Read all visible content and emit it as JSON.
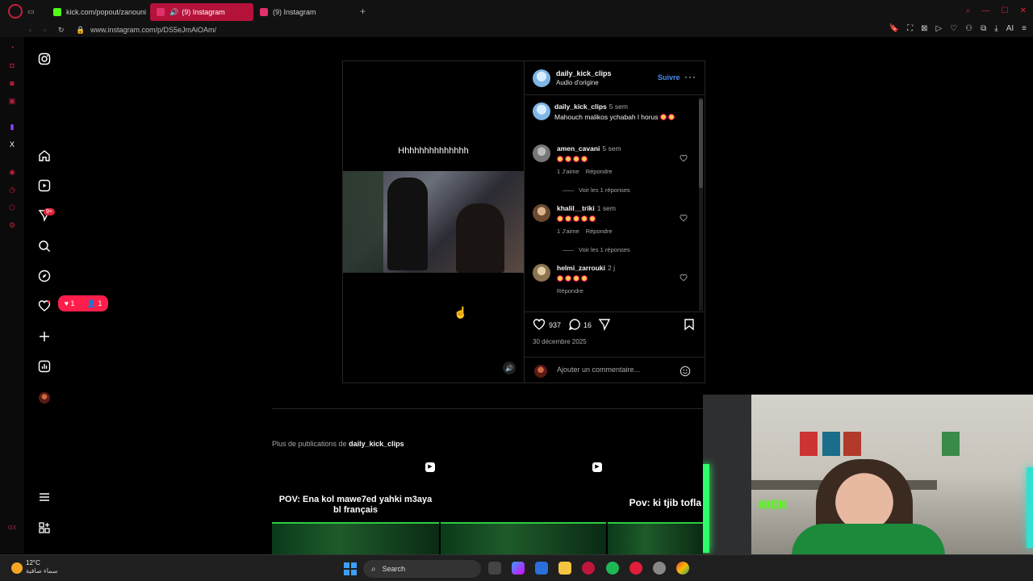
{
  "browser": {
    "tabs": [
      {
        "title": "kick.com/popout/zanouni",
        "favicon_color": "#53fc18"
      },
      {
        "title": "(9) Instagram",
        "favicon_color": "#e1306c",
        "active": true
      },
      {
        "title": "(9) Instagram",
        "favicon_color": "#e1306c"
      }
    ],
    "url": "www.instagram.com/p/DS5eJmAiOAm/",
    "ai_label": "AI"
  },
  "sidebar": {
    "notification_badge": "9+",
    "activity": {
      "likes": "1",
      "follows": "1"
    }
  },
  "post": {
    "author": "daily_kick_clips",
    "audio": "Audio d'origine",
    "follow_label": "Suivre",
    "video_caption": "Hhhhhhhhhhhhhh",
    "caption": {
      "user": "daily_kick_clips",
      "time": "5 sem",
      "text": "Mahouch malikos ychabah l horus"
    },
    "comments": [
      {
        "user": "amen_cavani",
        "time": "5 sem",
        "emojis": 4,
        "likes": "1 J'aime",
        "reply": "Répondre",
        "replies": "Voir les 1 réponses"
      },
      {
        "user": "khalil__triki",
        "time": "1 sem",
        "emojis": 5,
        "likes": "1 J'aime",
        "reply": "Répondre",
        "replies": "Voir les 1 réponses"
      },
      {
        "user": "helmi_zarrouki",
        "time": "2 j",
        "emojis": 4,
        "likes": "",
        "reply": "Répondre",
        "replies": ""
      }
    ],
    "like_count": "937",
    "comment_count": "16",
    "date": "30 décembre 2025",
    "add_comment_placeholder": "Ajouter un commentaire..."
  },
  "more_posts": {
    "prefix": "Plus de publications de",
    "user": "daily_kick_clips",
    "items": [
      {
        "text": "POV:  Ena kol mawe7ed yahki m3aya\nbl français"
      },
      {
        "text": ""
      },
      {
        "text": "Pov: ki tjib tofla"
      }
    ]
  },
  "taskbar": {
    "temperature": "12°C",
    "condition": "سماء صافية",
    "search_label": "Search"
  },
  "colors": {
    "accent": "#b5123a",
    "ig_blue": "#4a8df0",
    "kick_green": "#53fc18"
  }
}
